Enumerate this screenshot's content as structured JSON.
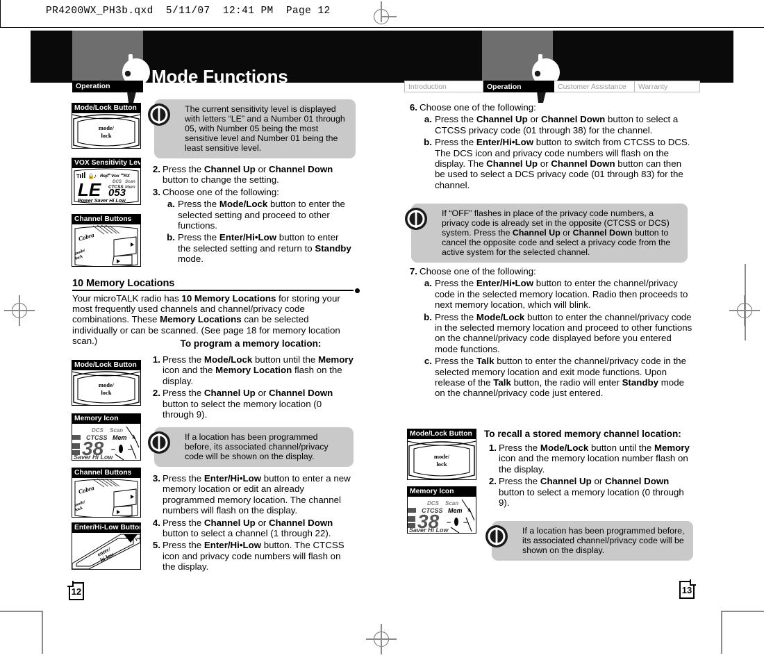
{
  "scan": {
    "header_text": "PR4200WX_PH3b.qxd  5/11/07  12:41 PM  Page 12"
  },
  "left_page": {
    "title": "Mode Functions",
    "spine_tab": "Operation",
    "page_number": "12",
    "figures": [
      {
        "caption": "Mode/Lock Button",
        "art": "mode-lock-button"
      },
      {
        "caption": "VOX Sensitivity Level",
        "art": "lcd-vox"
      },
      {
        "caption": "Channel Buttons",
        "art": "channel-buttons"
      },
      {
        "caption": "Mode/Lock Button",
        "art": "mode-lock-button"
      },
      {
        "caption": "Memory Icon",
        "art": "lcd-memory"
      },
      {
        "caption": "Channel Buttons",
        "art": "channel-buttons"
      },
      {
        "caption": "Enter/Hi-Low Button",
        "art": "enter-hilow-button"
      }
    ],
    "note_1": "The current sensitivity level is displayed with letters “LE” and a Number 01 through 05, with Number 05 being the most sensitive level and Number 01 being the least sensitive level.",
    "steps_top": [
      {
        "num": "2.",
        "text_html": "Press the <b>Channel Up</b> or <b>Channel Down</b> button to change the setting."
      },
      {
        "num": "3.",
        "text_html": "Choose one of the following:",
        "sub": [
          {
            "num": "a.",
            "text_html": "Press the <b>Mode/Lock</b> button to enter the selected setting and proceed to other functions."
          },
          {
            "num": "b.",
            "text_html": "Press the <b>Enter/Hi•Low</b> button to enter the selected setting and return to <b>Standby</b> mode."
          }
        ]
      }
    ],
    "section_heading": "10 Memory Locations",
    "section_body_html": "Your microTALK radio has <b>10 Memory Locations</b> for storing your most frequently used channels and channel/privacy code combinations. These <b>Memory Locations</b> can be selected individually or can be scanned. (See page 18 for memory location scan.)",
    "subheading": "To program a memory location:",
    "steps_program_a": [
      {
        "num": "1.",
        "text_html": "Press the <b>Mode/Lock</b> button until the <b>Memory</b> icon and the <b>Memory Location</b> flash on the display."
      },
      {
        "num": "2.",
        "text_html": "Press the <b>Channel Up</b> or <b>Channel Down</b> button to select the memory location (0 through 9)."
      }
    ],
    "note_2": "If a location has been programmed before, its associated channel/privacy code will be shown on the display.",
    "steps_program_b": [
      {
        "num": "3.",
        "text_html": "Press the <b>Enter/Hi•Low</b> button to enter a new memory location or edit an already programmed memory location. The channel numbers will flash on the display."
      },
      {
        "num": "4.",
        "text_html": "Press the <b>Channel Up</b> or <b>Channel Down</b> button to select a channel (1 through 22)."
      },
      {
        "num": "5.",
        "text_html": "Press the <b>Enter/Hi•Low</b> button. The CTCSS icon and privacy code numbers will flash on the display."
      }
    ]
  },
  "right_page": {
    "page_number": "13",
    "tabs": [
      {
        "label": "Introduction",
        "active": false
      },
      {
        "label": "Operation",
        "active": true
      },
      {
        "label": "Customer Assistance",
        "active": false
      },
      {
        "label": "Warranty",
        "active": false
      }
    ],
    "steps_6": [
      {
        "num": "6.",
        "text_html": "Choose one of the following:",
        "sub": [
          {
            "num": "a.",
            "text_html": "Press the <b>Channel Up</b> or <b>Channel Down</b> button to select a CTCSS privacy code (01 through 38) for the channel."
          },
          {
            "num": "b.",
            "text_html": "Press the <b>Enter/Hi•Low</b> button to switch from CTCSS to DCS. The DCS icon and privacy code numbers will flash on the display. The <b>Channel Up</b> or <b>Channel Down</b> button can then be used to select a DCS privacy code (01 through 83) for the channel."
          }
        ]
      }
    ],
    "note_1_html": "If “OFF” flashes in place of the privacy code numbers, a privacy code is already set in the opposite (CTCSS or DCS) system. Press the <b>Channel Up</b> or <b>Channel Down</b> button to cancel the opposite code and select a privacy code from the active system for the selected channel.",
    "steps_7": [
      {
        "num": "7.",
        "text_html": "Choose one of the following:",
        "sub": [
          {
            "num": "a.",
            "text_html": "Press the <b>Enter/Hi•Low</b> button to enter the channel/privacy code in the selected memory location. Radio then proceeds to next memory location, which will blink."
          },
          {
            "num": "b.",
            "text_html": "Press the <b>Mode/Lock</b> button to enter the channel/privacy code in the selected memory location and proceed to other functions on the channel/privacy code displayed before you entered mode functions."
          },
          {
            "num": "c.",
            "text_html": "Press the <b>Talk</b> button to enter the channel/privacy code in the selected memory location and exit mode functions. Upon release of the <b>Talk</b> button, the radio will enter <b>Standby</b> mode on the channel/privacy code just entered."
          }
        ]
      }
    ],
    "subheading": "To recall a stored memory channel location:",
    "steps_recall": [
      {
        "num": "1.",
        "text_html": "Press the <b>Mode/Lock</b> button until the <b>Memory</b> icon and the memory location number flash on the display."
      },
      {
        "num": "2.",
        "text_html": "Press the <b>Channel Up</b> or <b>Channel Down</b> button to select a memory location (0 through 9)."
      }
    ],
    "note_2": "If a location has been programmed before, its associated channel/privacy code will be shown on the display.",
    "figures": [
      {
        "caption": "Mode/Lock Button",
        "art": "mode-lock-button"
      },
      {
        "caption": "Memory Icon",
        "art": "lcd-memory"
      }
    ]
  },
  "lcd_vox": {
    "main": "LE",
    "sub": "053",
    "top_icons": [
      "Rep",
      "Vox",
      "RX"
    ],
    "mid_icons": [
      "DCS",
      "Scan",
      "CTCSS",
      "Mem"
    ],
    "bottom": "Power Saver Hi Low"
  },
  "lcd_memory": {
    "digits": "38",
    "labels": [
      "DCS",
      "Scan",
      "CTCSS",
      "Mem",
      "Saver",
      "Hi Low"
    ]
  },
  "button_labels": {
    "mode_lock": [
      "mode/",
      "lock"
    ],
    "enter_hilow": [
      "enter/",
      "hi-low"
    ],
    "brand": "Cobra"
  },
  "colors": {
    "banner": "#0a0a0a",
    "banner_grey": "#6e6e6e",
    "note_bg": "#c9c9c9",
    "tab_inactive_text": "#9a9a9a",
    "tab_border": "#b9b9b9"
  }
}
